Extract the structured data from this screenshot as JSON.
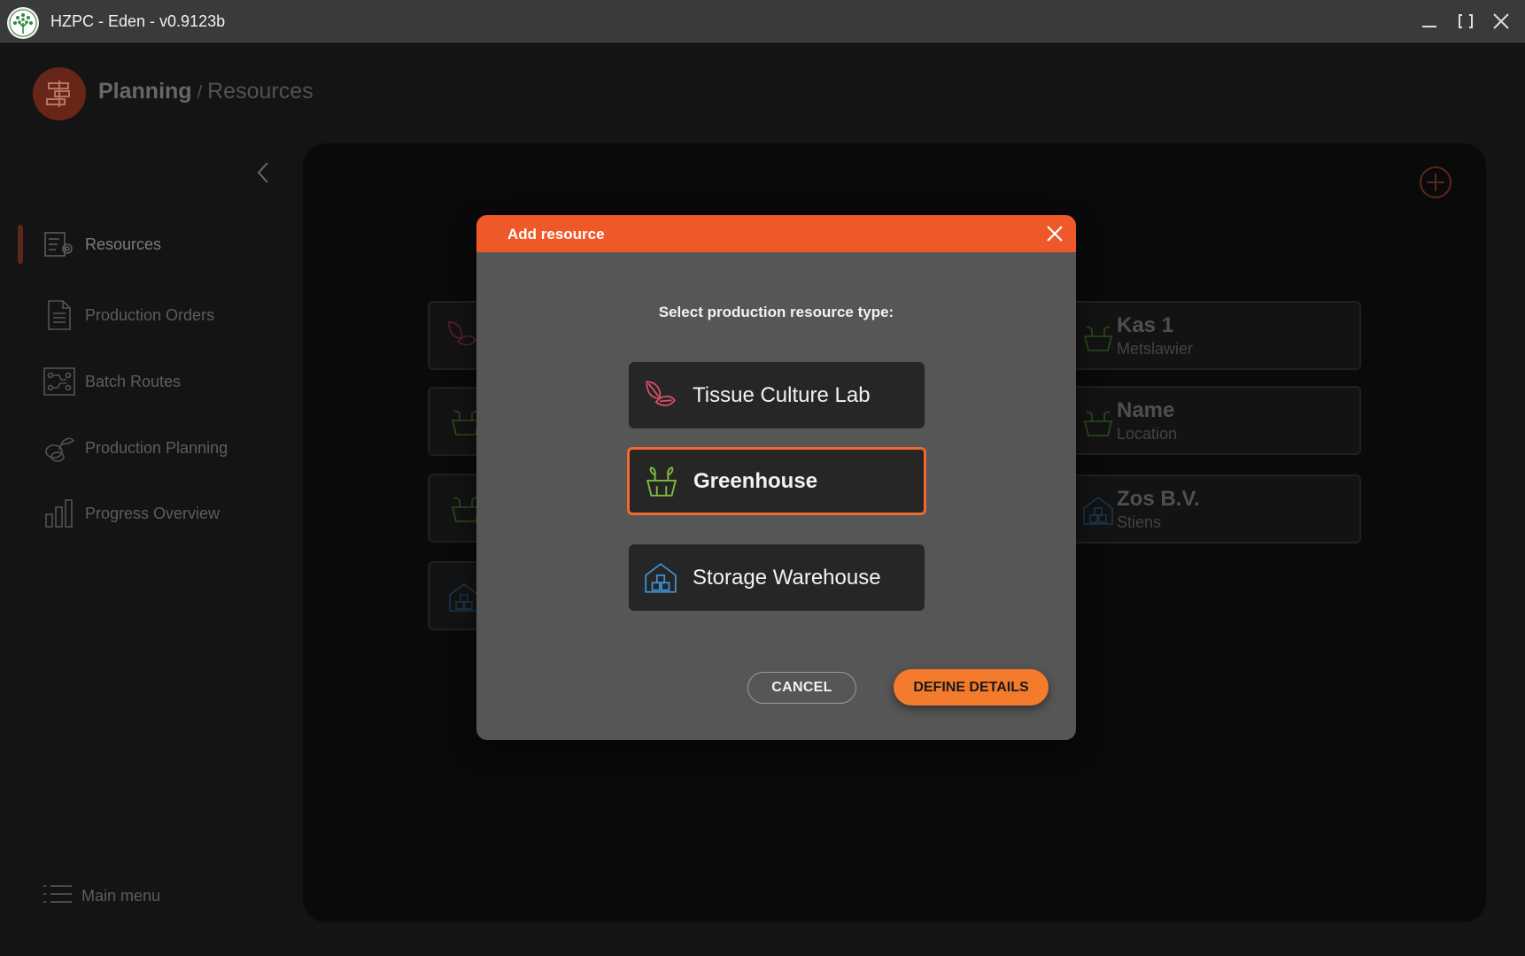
{
  "window": {
    "title": "HZPC - Eden - v0.9123b",
    "controls": [
      "minimize-icon",
      "maximize-icon",
      "close-icon"
    ]
  },
  "header": {
    "section": "Planning",
    "separator": "/",
    "page": "Resources"
  },
  "sidebar": {
    "items": [
      {
        "label": "Resources",
        "icon": "resources-icon",
        "active": true
      },
      {
        "label": "Production Orders",
        "icon": "document-icon"
      },
      {
        "label": "Batch Routes",
        "icon": "route-icon"
      },
      {
        "label": "Production Planning",
        "icon": "planning-icon"
      },
      {
        "label": "Progress Overview",
        "icon": "bar-chart-icon"
      }
    ],
    "main_menu": "Main menu"
  },
  "resources": [
    {
      "name": "Kas 1",
      "location": "Metslawier",
      "type": "greenhouse"
    },
    {
      "name": "Name",
      "location": "Location",
      "type": "greenhouse"
    },
    {
      "name": "Zos B.V.",
      "location": "Stiens",
      "type": "warehouse"
    }
  ],
  "dialog": {
    "title": "Add resource",
    "prompt": "Select production resource type:",
    "options": [
      {
        "label": "Tissue Culture Lab",
        "icon": "leaf-icon",
        "selected": false
      },
      {
        "label": "Greenhouse",
        "icon": "greenhouse-icon",
        "selected": true
      },
      {
        "label": "Storage Warehouse",
        "icon": "warehouse-icon",
        "selected": false
      }
    ],
    "cancel": "CANCEL",
    "confirm": "DEFINE DETAILS"
  },
  "colors": {
    "accent": "#ef5828",
    "button": "#f47a2c",
    "greenhouse_icon": "#7dbb3f",
    "lab_icon": "#e5506a",
    "warehouse_icon": "#3f8fd0"
  }
}
